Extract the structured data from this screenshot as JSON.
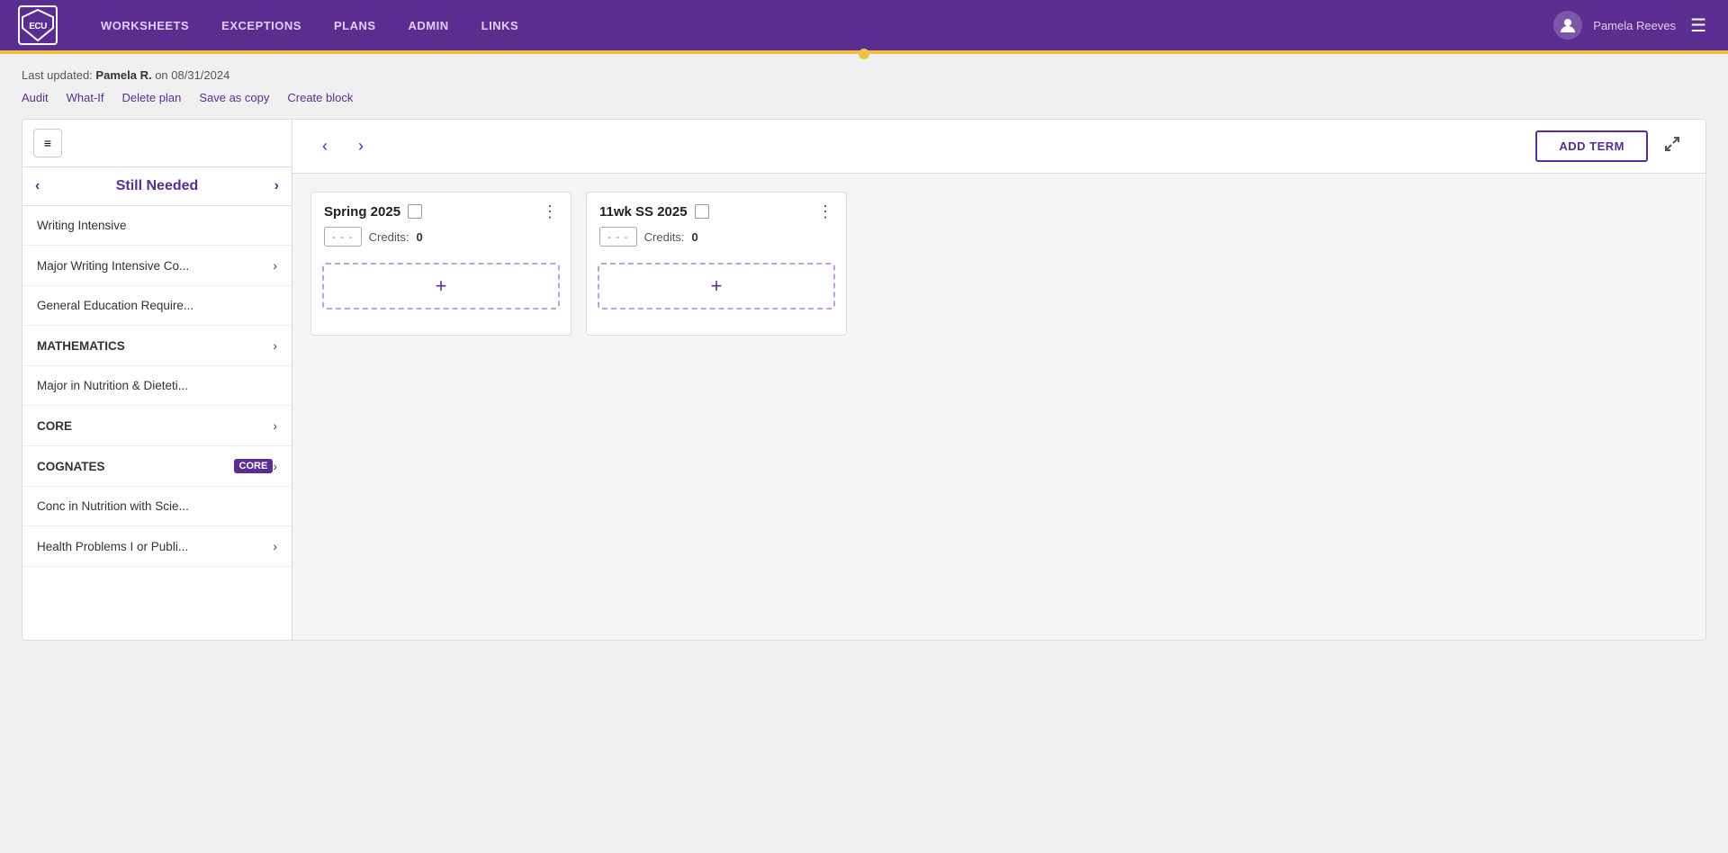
{
  "nav": {
    "logo_text": "ECU",
    "links": [
      {
        "id": "worksheets",
        "label": "WORKSHEETS"
      },
      {
        "id": "exceptions",
        "label": "EXCEPTIONS"
      },
      {
        "id": "plans",
        "label": "PLANS"
      },
      {
        "id": "admin",
        "label": "ADMIN"
      },
      {
        "id": "links",
        "label": "LINKS"
      }
    ],
    "user_name": "Pamela Reeves",
    "hamburger_label": "☰"
  },
  "meta": {
    "last_updated_prefix": "Last updated:",
    "last_updated_user": "Pamela R.",
    "last_updated_date": "on 08/31/2024"
  },
  "action_links": [
    {
      "id": "audit",
      "label": "Audit"
    },
    {
      "id": "what-if",
      "label": "What-If"
    },
    {
      "id": "delete-plan",
      "label": "Delete plan"
    },
    {
      "id": "save-as-copy",
      "label": "Save as copy"
    },
    {
      "id": "create-block",
      "label": "Create block"
    }
  ],
  "sidebar": {
    "title": "Still Needed",
    "hamburger_label": "≡",
    "items": [
      {
        "id": "writing-intensive",
        "label": "Writing Intensive",
        "has_chevron": false
      },
      {
        "id": "major-writing-intensive",
        "label": "Major Writing Intensive Co...",
        "has_chevron": true
      },
      {
        "id": "general-education",
        "label": "General Education Require...",
        "has_chevron": false
      },
      {
        "id": "mathematics",
        "label": "MATHEMATICS",
        "has_chevron": true,
        "bold": true
      },
      {
        "id": "major-nutrition",
        "label": "Major in Nutrition & Dieteti...",
        "has_chevron": false
      },
      {
        "id": "core",
        "label": "CORE",
        "has_chevron": true,
        "bold": true
      },
      {
        "id": "cognates-core",
        "label": "COGNATES",
        "has_chevron": true,
        "bold": true,
        "badge": "CORE"
      },
      {
        "id": "conc-nutrition",
        "label": "Conc in Nutrition with Scie...",
        "has_chevron": false
      },
      {
        "id": "health-problems",
        "label": "Health Problems I or Publi...",
        "has_chevron": true
      }
    ]
  },
  "toolbar": {
    "prev_label": "‹",
    "next_label": "›",
    "add_term_label": "ADD TERM",
    "expand_label": "⤢"
  },
  "terms": [
    {
      "id": "spring-2025",
      "title": "Spring 2025",
      "credits_slot": "- - -",
      "credits_label": "Credits:",
      "credits_value": "0",
      "add_btn_label": "+"
    },
    {
      "id": "11wk-ss-2025",
      "title": "11wk SS 2025",
      "credits_slot": "- - -",
      "credits_label": "Credits:",
      "credits_value": "0",
      "add_btn_label": "+"
    }
  ]
}
